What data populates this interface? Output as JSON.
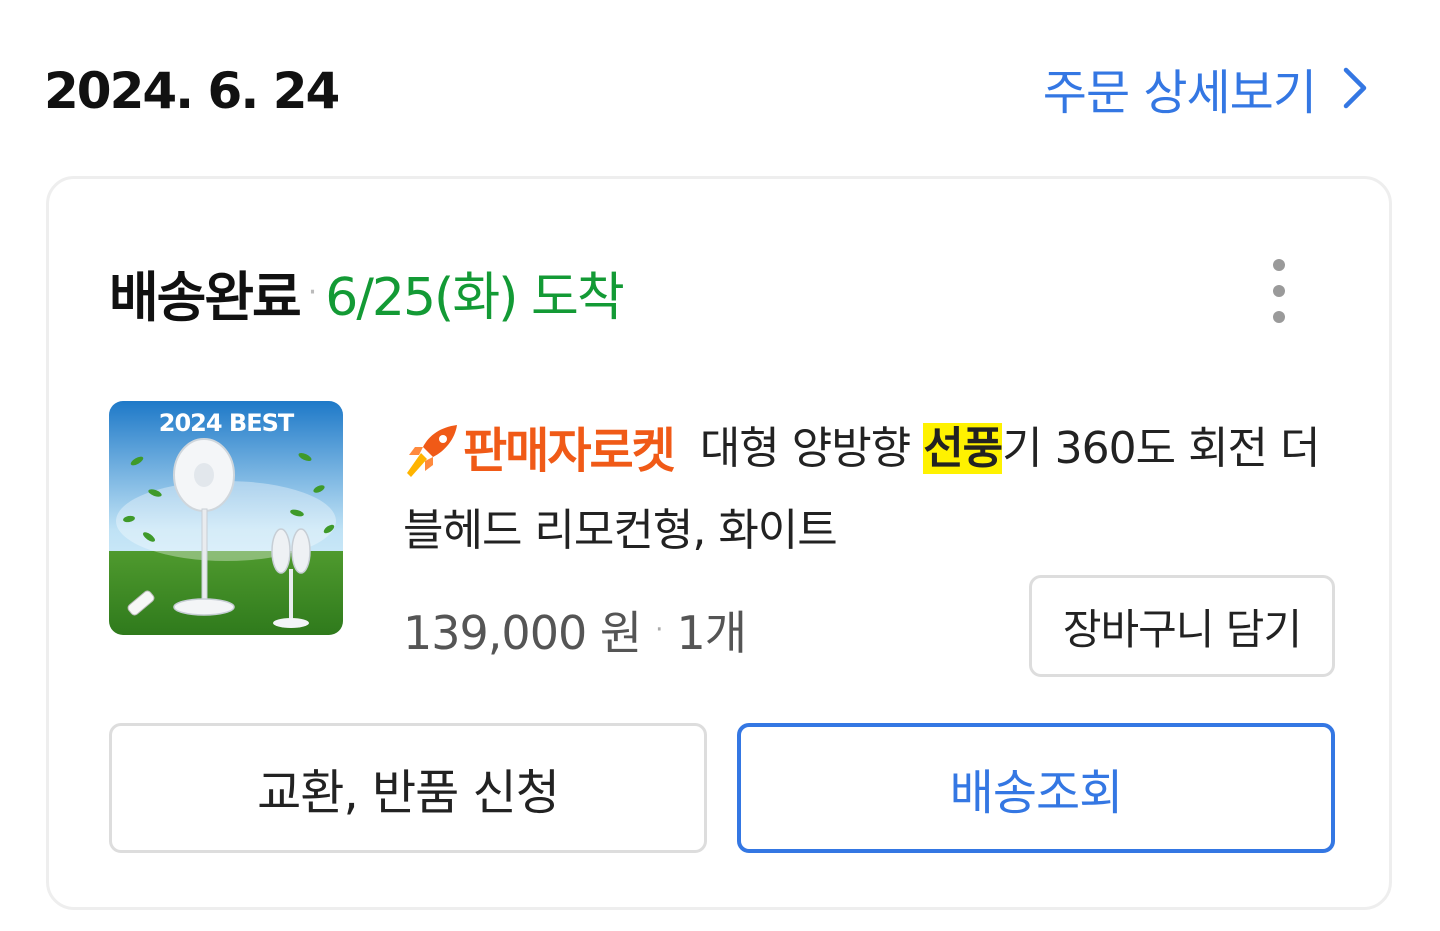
{
  "order": {
    "date": "2024. 6. 24",
    "detail_link": "주문 상세보기"
  },
  "shipment": {
    "status": "배송완료",
    "separator": "·",
    "arrival": "6/25(화) 도착",
    "more_icon": "more-vertical-icon"
  },
  "product": {
    "thumbnail_badge": "2024 BEST",
    "seller_badge": "판매자로켓",
    "seller_badge_icon": "rocket-icon",
    "title_before": "대형 양방향 ",
    "title_highlight": "선풍",
    "title_after": "기 360도 회전 더블헤드 리모컨형, 화이트",
    "price": "139,000 원",
    "quantity_separator": "·",
    "quantity": "1개",
    "add_to_cart_label": "장바구니 담기"
  },
  "actions": {
    "exchange_return_label": "교환, 반품 신청",
    "track_delivery_label": "배송조회"
  },
  "colors": {
    "link_blue": "#3477e3",
    "arrival_green": "#139a35",
    "rocket_orange": "#f05a17",
    "highlight_yellow": "#fff200"
  }
}
